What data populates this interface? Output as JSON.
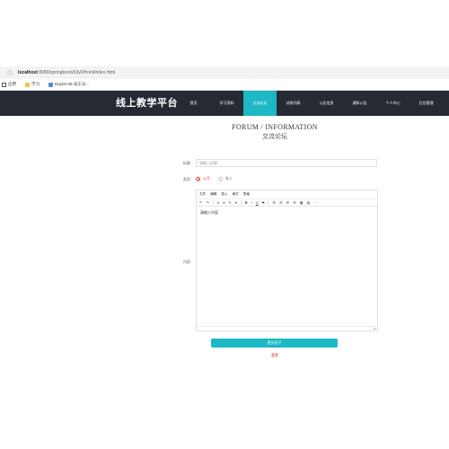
{
  "browser": {
    "address_host": "localhost",
    "address_path": ":8080/springbootx53y0/front/index.html",
    "bookmarks": [
      {
        "icon": "grid-icon",
        "label": "应用"
      },
      {
        "icon": "folder-icon",
        "label": "学习"
      },
      {
        "icon": "task-icon",
        "label": "Day02-05-员工分..."
      }
    ]
  },
  "site": {
    "logo": "线上教学平台",
    "nav": [
      {
        "label": "首页"
      },
      {
        "label": "学习资料"
      },
      {
        "label": "交流论坛"
      },
      {
        "label": "试卷列表"
      },
      {
        "label": "公告信息"
      },
      {
        "label": "通知公告"
      },
      {
        "label": "个人中心"
      },
      {
        "label": "后台管理"
      }
    ],
    "active_nav": "交流论坛",
    "accent_color": "#1cb8c4",
    "nav_bg_color": "#262a33"
  },
  "page": {
    "heading_en": "FORUM / INFORMATION",
    "heading_zh": "交流论坛"
  },
  "form": {
    "title_label": "标题:",
    "title_placeholder": "请输入标题",
    "type_label": "类型:",
    "type_options": [
      {
        "label": "公开",
        "checked": true
      },
      {
        "label": "私人",
        "checked": false
      }
    ],
    "content_label": "内容:",
    "editor_menu": [
      "文件",
      "编辑",
      "插入",
      "格式",
      "表格"
    ],
    "editor_toolbar": [
      "↶",
      "↷",
      "A",
      "▾",
      "✎",
      "▾",
      "B",
      "I",
      "U",
      "S",
      "☰",
      "☰",
      "☰",
      "☰",
      "▦",
      "▤",
      "⋯"
    ],
    "editor_placeholder": "请输入内容",
    "editor_status": "⟋ ◢",
    "submit_label": "提交帖子",
    "reset_label": "重置"
  }
}
